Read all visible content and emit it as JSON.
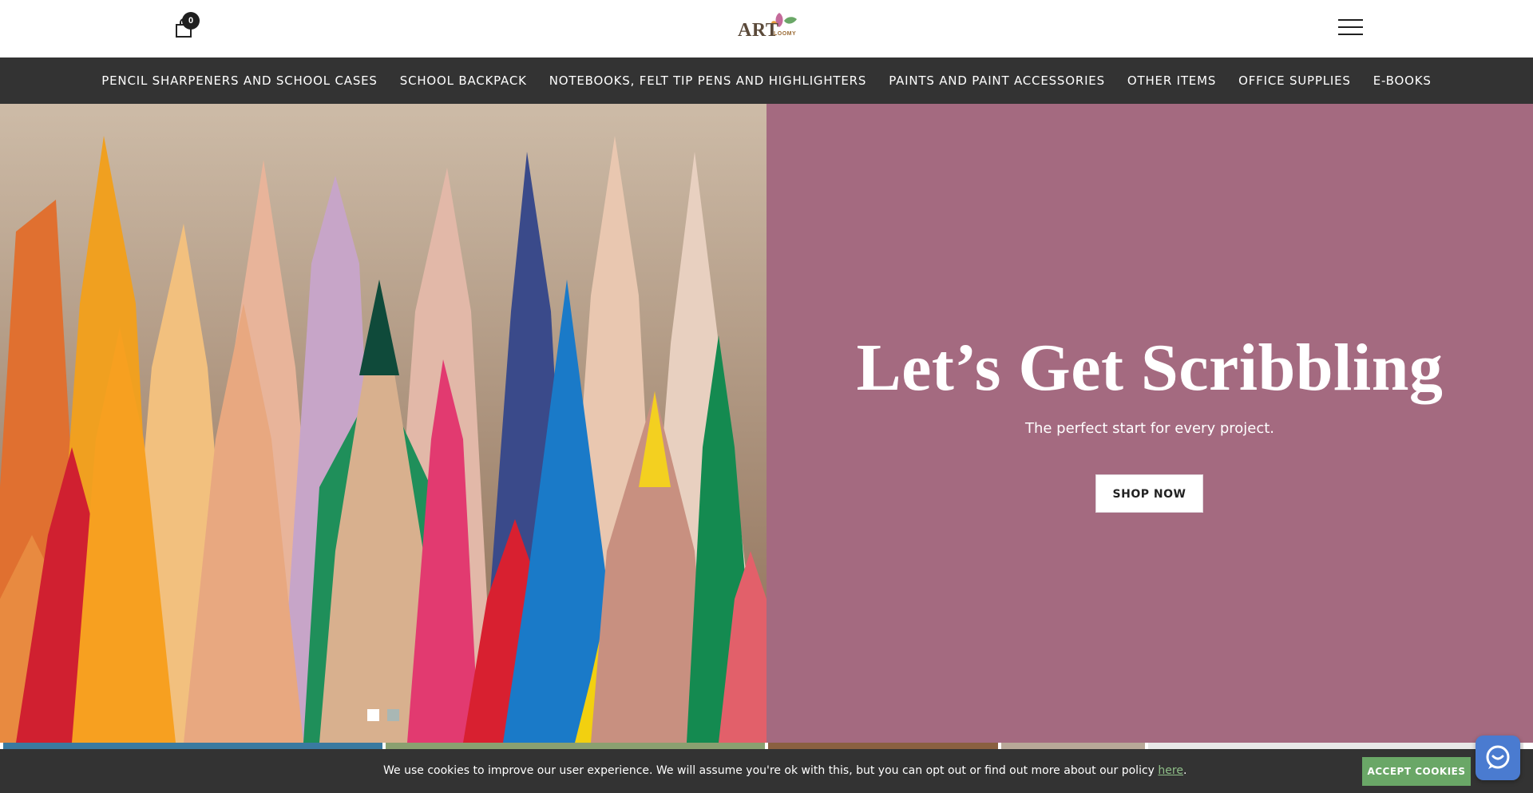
{
  "header": {
    "cart_count": "0",
    "logo_text": "ART",
    "logo_sub": "LOOMY"
  },
  "nav": {
    "items": [
      "PENCIL SHARPENERS AND SCHOOL CASES",
      "SCHOOL BACKPACK",
      "NOTEBOOKS, FELT TIP PENS AND HIGHLIGHTERS",
      "PAINTS AND PAINT ACCESSORIES",
      "OTHER ITEMS",
      "OFFICE SUPPLIES",
      "E-BOOKS"
    ]
  },
  "hero": {
    "title": "Let’s Get Scribbling",
    "subtitle": "The perfect start for every project.",
    "button_label": "SHOP NOW",
    "panel_color": "#a46a80",
    "slides": [
      {
        "active": true,
        "color": "#ffffff"
      },
      {
        "active": false,
        "color": "#a9b7b4"
      }
    ]
  },
  "cookie": {
    "text": "We use cookies to improve our user experience. We will assume you're ok with this, but you can opt out or find out more about our policy ",
    "link_text": "here",
    "suffix": ".",
    "button_label": "ACCEPT COOKIES"
  },
  "colors": {
    "nav_bg": "#333333",
    "accept_green": "#6aa767",
    "chat_blue": "#4a7bd0"
  },
  "icons": {
    "cart": "shopping-bag-icon",
    "menu": "hamburger-menu-icon",
    "chat": "chat-bubble-icon"
  }
}
